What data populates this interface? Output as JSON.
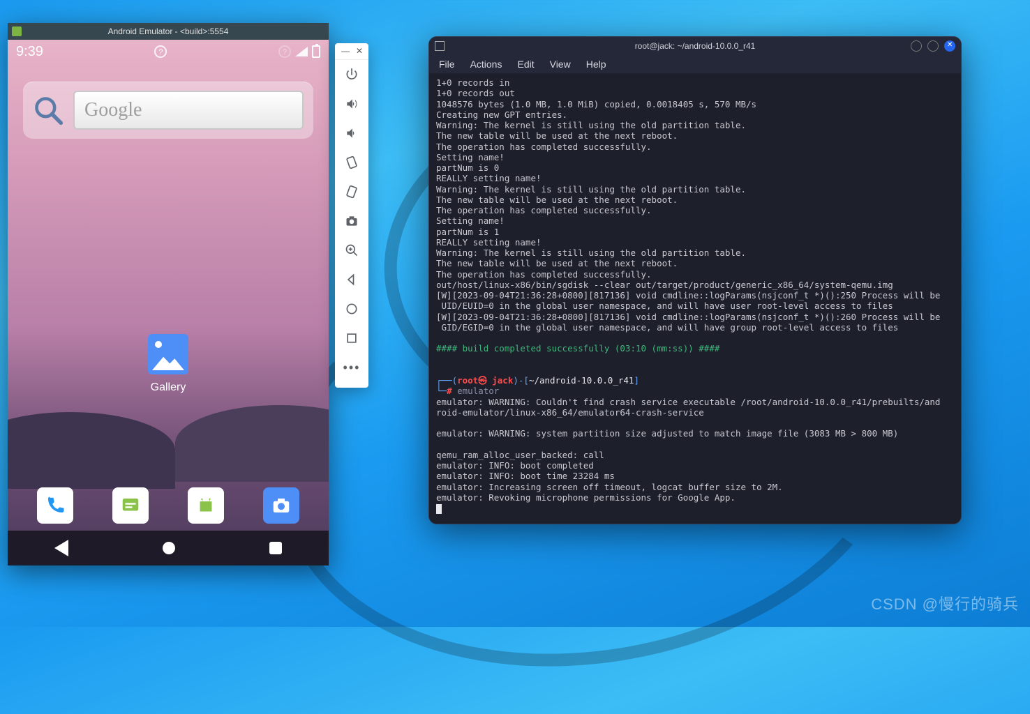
{
  "watermark": "CSDN @慢行的骑兵",
  "emulator": {
    "window_title": "Android Emulator - <build>:5554",
    "status": {
      "time": "9:39"
    },
    "search": {
      "placeholder": "Google"
    },
    "gallery_label": "Gallery",
    "dock": [
      "phone",
      "messaging",
      "android",
      "camera"
    ],
    "toolbar_buttons": [
      "power",
      "volume-up",
      "volume-down",
      "rotate-left",
      "rotate-right",
      "screenshot",
      "zoom",
      "back",
      "home",
      "overview",
      "more"
    ]
  },
  "terminal": {
    "title": "root@jack: ~/android-10.0.0_r41",
    "menu": [
      "File",
      "Actions",
      "Edit",
      "View",
      "Help"
    ],
    "output": [
      "1+0 records in",
      "1+0 records out",
      "1048576 bytes (1.0 MB, 1.0 MiB) copied, 0.0018405 s, 570 MB/s",
      "Creating new GPT entries.",
      "Warning: The kernel is still using the old partition table.",
      "The new table will be used at the next reboot.",
      "The operation has completed successfully.",
      "Setting name!",
      "partNum is 0",
      "REALLY setting name!",
      "Warning: The kernel is still using the old partition table.",
      "The new table will be used at the next reboot.",
      "The operation has completed successfully.",
      "Setting name!",
      "partNum is 1",
      "REALLY setting name!",
      "Warning: The kernel is still using the old partition table.",
      "The new table will be used at the next reboot.",
      "The operation has completed successfully.",
      "out/host/linux-x86/bin/sgdisk --clear out/target/product/generic_x86_64/system-qemu.img",
      "[W][2023-09-04T21:36:28+0800][817136] void cmdline::logParams(nsjconf_t *)():250 Process will be",
      " UID/EUID=0 in the global user namespace, and will have user root-level access to files",
      "[W][2023-09-04T21:36:28+0800][817136] void cmdline::logParams(nsjconf_t *)():260 Process will be",
      " GID/EGID=0 in the global user namespace, and will have group root-level access to files"
    ],
    "build_line": "#### build completed successfully (03:10 (mm:ss)) ####",
    "prompt": {
      "user": "root",
      "at": "㉿",
      "host": "jack",
      "path": "~/android-10.0.0_r41",
      "command": "emulator"
    },
    "output2": [
      "emulator: WARNING: Couldn't find crash service executable /root/android-10.0.0_r41/prebuilts/and",
      "roid-emulator/linux-x86_64/emulator64-crash-service",
      "",
      "emulator: WARNING: system partition size adjusted to match image file (3083 MB > 800 MB)",
      "",
      "qemu_ram_alloc_user_backed: call",
      "emulator: INFO: boot completed",
      "emulator: INFO: boot time 23284 ms",
      "emulator: Increasing screen off timeout, logcat buffer size to 2M.",
      "emulator: Revoking microphone permissions for Google App."
    ]
  }
}
